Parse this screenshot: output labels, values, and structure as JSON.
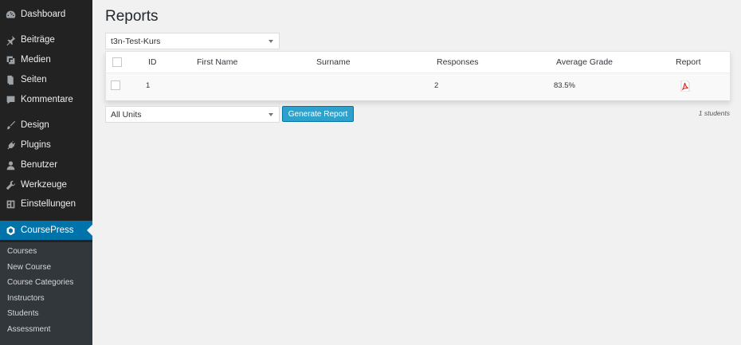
{
  "sidebar": {
    "items": [
      {
        "label": "Dashboard",
        "icon": "dashboard-icon"
      },
      {
        "label": "Beiträge",
        "icon": "pin-icon"
      },
      {
        "label": "Medien",
        "icon": "media-icon"
      },
      {
        "label": "Seiten",
        "icon": "pages-icon"
      },
      {
        "label": "Kommentare",
        "icon": "comment-icon"
      },
      {
        "label": "Design",
        "icon": "brush-icon"
      },
      {
        "label": "Plugins",
        "icon": "plug-icon"
      },
      {
        "label": "Benutzer",
        "icon": "user-icon"
      },
      {
        "label": "Werkzeuge",
        "icon": "wrench-icon"
      },
      {
        "label": "Einstellungen",
        "icon": "settings-icon"
      },
      {
        "label": "CoursePress",
        "icon": "coursepress-icon"
      }
    ],
    "submenu": [
      "Courses",
      "New Course",
      "Course Categories",
      "Instructors",
      "Students",
      "Assessment"
    ]
  },
  "page": {
    "title": "Reports",
    "course_select": "t3n-Test-Kurs",
    "units_select": "All Units",
    "generate_label": "Generate Report",
    "student_count": "1 students"
  },
  "table": {
    "headers": {
      "id": "ID",
      "first_name": "First Name",
      "surname": "Surname",
      "responses": "Responses",
      "average_grade": "Average Grade",
      "report": "Report"
    },
    "rows": [
      {
        "id": "1",
        "first_name": "",
        "surname": "",
        "responses": "2",
        "average_grade": "83.5%",
        "report_icon": "pdf-icon"
      }
    ]
  },
  "colors": {
    "accent": "#0073aa",
    "sidebar_bg": "#222222",
    "button": "#2ea2cc"
  }
}
